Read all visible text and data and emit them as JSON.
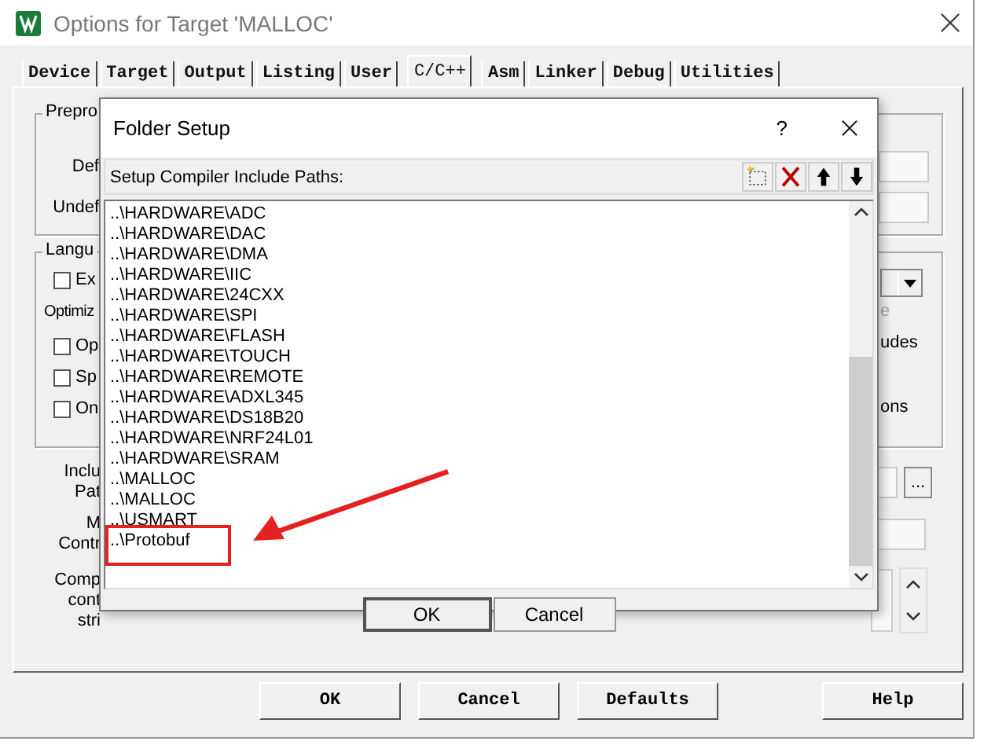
{
  "window": {
    "title": "Options for Target 'MALLOC'"
  },
  "tabs": [
    {
      "label": "Device",
      "selected": false
    },
    {
      "label": "Target",
      "selected": false
    },
    {
      "label": "Output",
      "selected": false
    },
    {
      "label": "Listing",
      "selected": false
    },
    {
      "label": "User",
      "selected": false
    },
    {
      "label": "C/C++",
      "selected": true
    },
    {
      "label": "Asm",
      "selected": false
    },
    {
      "label": "Linker",
      "selected": false
    },
    {
      "label": "Debug",
      "selected": false
    },
    {
      "label": "Utilities",
      "selected": false
    }
  ],
  "preprocessor": {
    "title": "Prepro",
    "labels": [
      "Def",
      "Undef"
    ]
  },
  "language": {
    "title": "Langu",
    "top_checkbox": {
      "label": "Ex",
      "checked": false
    },
    "optimiz_label": "Optimiz",
    "checkboxes": [
      {
        "label": "Op",
        "checked": false
      },
      {
        "label": "Sp",
        "checked": false
      },
      {
        "label": "On",
        "checked": false
      }
    ],
    "right_texts": [
      {
        "text": "e",
        "disabled": true
      },
      {
        "text": "udes",
        "disabled": false
      },
      {
        "text": "ons",
        "disabled": false
      }
    ]
  },
  "include_label": [
    "Inclu",
    "Pat"
  ],
  "browse_button": "...",
  "misc_label": [
    "M",
    "Contr"
  ],
  "compiler_label": [
    "Comp",
    "cont",
    "stri"
  ],
  "buttons": [
    "OK",
    "Cancel",
    "Defaults",
    "Help"
  ],
  "folder_setup": {
    "title": "Folder Setup",
    "help": "?",
    "list_label": "Setup Compiler Include Paths:",
    "paths": [
      "..\\HARDWARE\\ADC",
      "..\\HARDWARE\\DAC",
      "..\\HARDWARE\\DMA",
      "..\\HARDWARE\\IIC",
      "..\\HARDWARE\\24CXX",
      "..\\HARDWARE\\SPI",
      "..\\HARDWARE\\FLASH",
      "..\\HARDWARE\\TOUCH",
      "..\\HARDWARE\\REMOTE",
      "..\\HARDWARE\\ADXL345",
      "..\\HARDWARE\\DS18B20",
      "..\\HARDWARE\\NRF24L01",
      "..\\HARDWARE\\SRAM",
      "..\\MALLOC",
      "..\\MALLOC",
      "..\\USMART",
      "..\\Protobuf"
    ],
    "buttons": [
      "OK",
      "Cancel"
    ]
  }
}
